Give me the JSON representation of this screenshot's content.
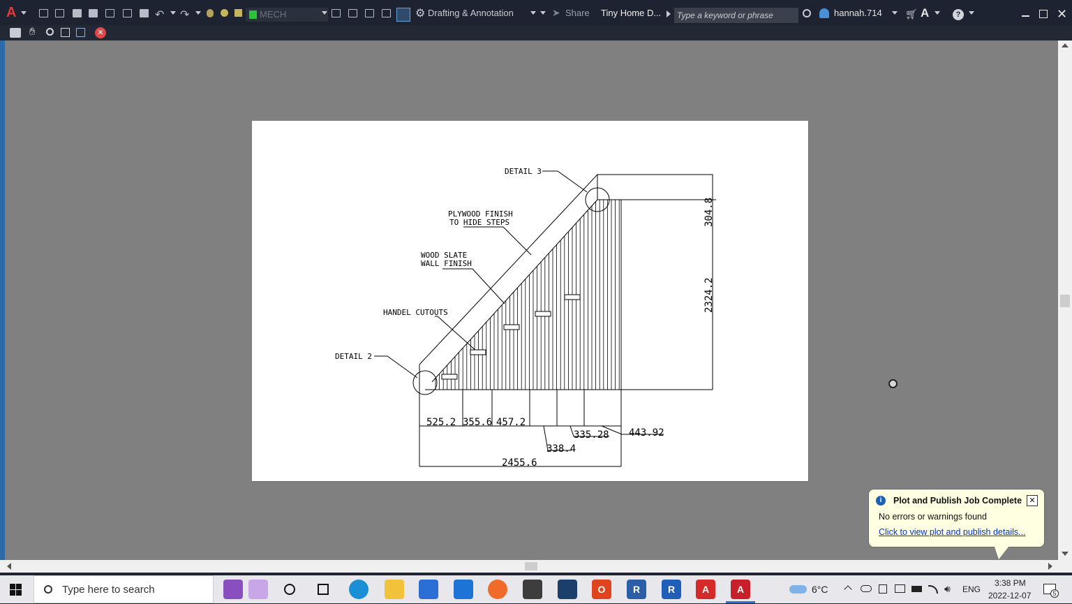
{
  "titlebar": {
    "layer_name": "MECH",
    "workspace": "Drafting & Annotation",
    "share_label": "Share",
    "doc_title": "Tiny Home D...",
    "search_placeholder": "Type a keyword or phrase",
    "username": "hannah.714"
  },
  "drawing": {
    "labels": {
      "detail3": "DETAIL 3",
      "plywood1": "PLYWOOD FINISH",
      "plywood2": "TO HIDE STEPS",
      "wood1": "WOOD SLATE",
      "wood2": "WALL FINISH",
      "handel": "HANDEL CUTOUTS",
      "detail2": "DETAIL 2"
    },
    "dims": {
      "d1": "525.2",
      "d2": "355.6",
      "d3": "457.2",
      "d4": "338.4",
      "d5": "335.28",
      "d6": "443.92",
      "total": "2455.6",
      "right_top": "304.8",
      "right_main": "2324.2"
    }
  },
  "notification": {
    "title": "Plot and Publish Job Complete",
    "message": "No errors or warnings found",
    "link": "Click to view plot and publish details..."
  },
  "taskbar": {
    "search_placeholder": "Type here to search",
    "weather": "6°C",
    "language": "ENG",
    "time": "3:38 PM",
    "date": "2022-12-07",
    "notif_count": "5"
  }
}
